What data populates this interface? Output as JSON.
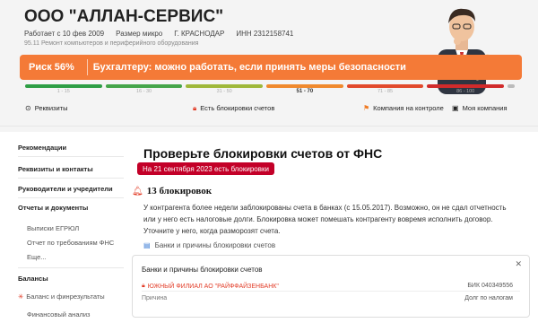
{
  "header": {
    "company_name": "ООО \"АЛЛАН-СЕРВИС\"",
    "registered": "Работает с 10 фев 2009",
    "size": "Размер микро",
    "city": "Г. КРАСНОДАР",
    "inn": "ИНН 2312158741",
    "okved": "95.11 Ремонт компьютеров и периферийного оборудования"
  },
  "risk": {
    "percent_label": "Риск 56%",
    "message": "Бухгалтеру: можно работать, если принять меры безопасности",
    "scale": [
      {
        "label": "1 - 15",
        "color": "#2e9e45",
        "active": false
      },
      {
        "label": "16 - 30",
        "color": "#45a54a",
        "active": false
      },
      {
        "label": "31 - 50",
        "color": "#9fb83a",
        "active": false
      },
      {
        "label": "51 - 70",
        "color": "#f08a2e",
        "active": true
      },
      {
        "label": "71 - 85",
        "color": "#e24a2c",
        "active": false
      },
      {
        "label": "86 - 100",
        "color": "#d12b2b",
        "active": false
      }
    ],
    "value": 56
  },
  "actions": {
    "requisites": "Реквизиты",
    "blocks": "Есть блокировки счетов",
    "control": "Компания на контроле",
    "mine": "Моя компания"
  },
  "sidebar": {
    "recommendations": "Рекомендации",
    "requisites_contacts": "Реквизиты и контакты",
    "management": "Руководители и учредители",
    "reports": "Отчеты и документы",
    "egrul": "Выписки ЕГРЮЛ",
    "fns_report": "Отчет по требованиям ФНС",
    "more": "Еще...",
    "balances": "Балансы",
    "balance_results": "Баланс и финрезультаты",
    "fin_analysis": "Финансовый анализ"
  },
  "main": {
    "heading": "Проверьте блокировки счетов от ФНС",
    "badge": "На 21 сентября 2023 есть блокировки",
    "count": "13 блокировок",
    "paragraph": "У контрагента более недели заблокированы счета в банках (с 15.05.2017). Возможно, он не сдал отчетность или у него есть налоговые долги. Блокировка может помешать контрагенту вовремя исполнить договор. Уточните у него, когда разморозят счета.",
    "link": "Банки и причины блокировки счетов"
  },
  "card": {
    "title": "Банки и причины блокировки счетов",
    "bank": "ЮЖНЫЙ ФИЛИАЛ АО \"РАЙФФАЙЗЕНБАНК\"",
    "bik": "БИК 040349556",
    "reason_label": "Причина",
    "reason_value": "Долг по налогам"
  },
  "colors": {
    "risk_bg": "#f47a37",
    "badge_bg": "#c30028",
    "accent_red": "#e23b26"
  }
}
